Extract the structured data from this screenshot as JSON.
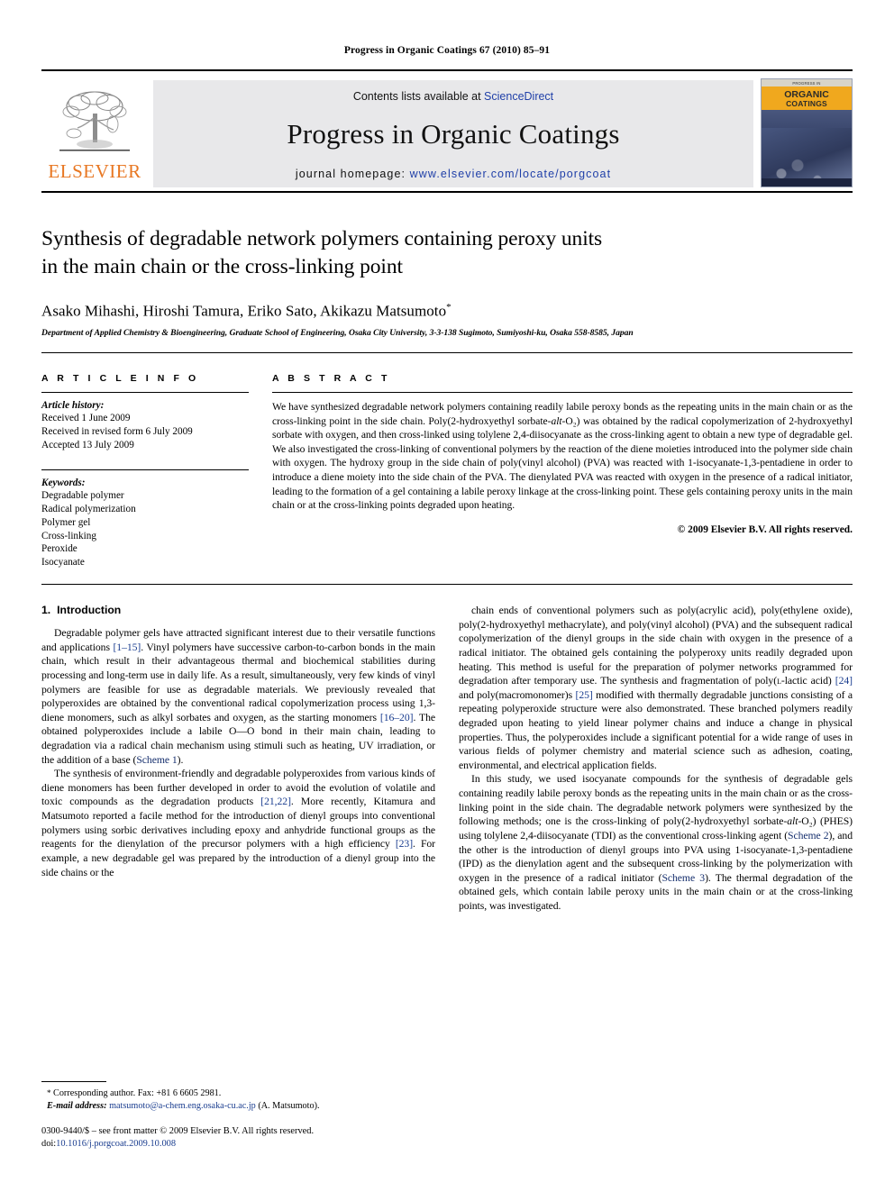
{
  "running_head": "Progress in Organic Coatings 67 (2010) 85–91",
  "masthead": {
    "publisher_name": "ELSEVIER",
    "contents_prefix": "Contents lists available at ",
    "contents_link": "ScienceDirect",
    "journal_title": "Progress in Organic Coatings",
    "homepage_prefix": "journal homepage: ",
    "homepage_url": "www.elsevier.com/locate/porgcoat",
    "cover": {
      "top_text": "PROGRESS IN",
      "band_title": "ORGANIC",
      "band_subtitle": "COATINGS"
    }
  },
  "article": {
    "title_line1": "Synthesis of degradable network polymers containing peroxy units",
    "title_line2": "in the main chain or the cross-linking point",
    "authors": "Asako Mihashi, Hiroshi Tamura, Eriko Sato, Akikazu Matsumoto",
    "author_marker": "*",
    "affiliation": "Department of Applied Chemistry & Bioengineering, Graduate School of Engineering, Osaka City University, 3-3-138 Sugimoto, Sumiyoshi-ku, Osaka 558-8585, Japan"
  },
  "info": {
    "heading": "A R T I C L E    I N F O",
    "history_label": "Article history:",
    "history": [
      "Received 1 June 2009",
      "Received in revised form 6 July 2009",
      "Accepted 13 July 2009"
    ],
    "keywords_label": "Keywords:",
    "keywords": [
      "Degradable polymer",
      "Radical polymerization",
      "Polymer gel",
      "Cross-linking",
      "Peroxide",
      "Isocyanate"
    ]
  },
  "abstract": {
    "heading": "A B S T R A C T",
    "text": "We have synthesized degradable network polymers containing readily labile peroxy bonds as the repeating units in the main chain or as the cross-linking point in the side chain. Poly(2-hydroxyethyl sorbate-alt-O₂) was obtained by the radical copolymerization of 2-hydroxyethyl sorbate with oxygen, and then cross-linked using tolylene 2,4-diisocyanate as the cross-linking agent to obtain a new type of degradable gel. We also investigated the cross-linking of conventional polymers by the reaction of the diene moieties introduced into the polymer side chain with oxygen. The hydroxy group in the side chain of poly(vinyl alcohol) (PVA) was reacted with 1-isocyanate-1,3-pentadiene in order to introduce a diene moiety into the side chain of the PVA. The dienylated PVA was reacted with oxygen in the presence of a radical initiator, leading to the formation of a gel containing a labile peroxy linkage at the cross-linking point. These gels containing peroxy units in the main chain or at the cross-linking points degraded upon heating.",
    "copyright": "© 2009 Elsevier B.V. All rights reserved."
  },
  "introduction": {
    "number": "1.",
    "heading": "Introduction",
    "left_paragraph_1": "Degradable polymer gels have attracted significant interest due to their versatile functions and applications [1–15]. Vinyl polymers have successive carbon-to-carbon bonds in the main chain, which result in their advantageous thermal and biochemical stabilities during processing and long-term use in daily life. As a result, simultaneously, very few kinds of vinyl polymers are feasible for use as degradable materials. We previously revealed that polyperoxides are obtained by the conventional radical copolymerization process using 1,3-diene monomers, such as alkyl sorbates and oxygen, as the starting monomers [16–20]. The obtained polyperoxides include a labile O—O bond in their main chain, leading to degradation via a radical chain mechanism using stimuli such as heating, UV irradiation, or the addition of a base (Scheme 1).",
    "left_paragraph_2": "The synthesis of environment-friendly and degradable polyperoxides from various kinds of diene monomers has been further developed in order to avoid the evolution of volatile and toxic compounds as the degradation products [21,22]. More recently, Kitamura and Matsumoto reported a facile method for the introduction of dienyl groups into conventional polymers using sorbic derivatives including epoxy and anhydride functional groups as the reagents for the dienylation of the precursor polymers with a high efficiency [23]. For example, a new degradable gel was prepared by the introduction of a dienyl group into the side chains or the",
    "right_paragraph_1": "chain ends of conventional polymers such as poly(acrylic acid), poly(ethylene oxide), poly(2-hydroxyethyl methacrylate), and poly(vinyl alcohol) (PVA) and the subsequent radical copolymerization of the dienyl groups in the side chain with oxygen in the presence of a radical initiator. The obtained gels containing the polyperoxy units readily degraded upon heating. This method is useful for the preparation of polymer networks programmed for degradation after temporary use. The synthesis and fragmentation of poly(L-lactic acid) [24] and poly(macromonomer)s [25] modified with thermally degradable junctions consisting of a repeating polyperoxide structure were also demonstrated. These branched polymers readily degraded upon heating to yield linear polymer chains and induce a change in physical properties. Thus, the polyperoxides include a significant potential for a wide range of uses in various fields of polymer chemistry and material science such as adhesion, coating, environmental, and electrical application fields.",
    "right_paragraph_2": "In this study, we used isocyanate compounds for the synthesis of degradable gels containing readily labile peroxy bonds as the repeating units in the main chain or as the cross-linking point in the side chain. The degradable network polymers were synthesized by the following methods; one is the cross-linking of poly(2-hydroxyethyl sorbate-alt-O₂) (PHES) using tolylene 2,4-diisocyanate (TDI) as the conventional cross-linking agent (Scheme 2), and the other is the introduction of dienyl groups into PVA using 1-isocyanate-1,3-pentadiene (IPD) as the dienylation agent and the subsequent cross-linking by the polymerization with oxygen in the presence of a radical initiator (Scheme 3). The thermal degradation of the obtained gels, which contain labile peroxy units in the main chain or at the cross-linking points, was investigated."
  },
  "footnote": {
    "marker": "*",
    "corresponding": "Corresponding author. Fax: +81 6 6605 2981.",
    "email_label": "E-mail address:",
    "email": "matsumoto@a-chem.eng.osaka-cu.ac.jp",
    "email_suffix": "(A. Matsumoto).",
    "issn_line": "0300-9440/$ – see front matter © 2009 Elsevier B.V. All rights reserved.",
    "doi_label": "doi:",
    "doi_value": "10.1016/j.porgcoat.2009.10.008"
  },
  "colors": {
    "link_blue": "#1f3fa8",
    "citation_blue": "#1a3d8f",
    "elsevier_orange": "#E87722",
    "band_gray": "#e8e8ea",
    "cover_orange": "#f0a81e"
  }
}
